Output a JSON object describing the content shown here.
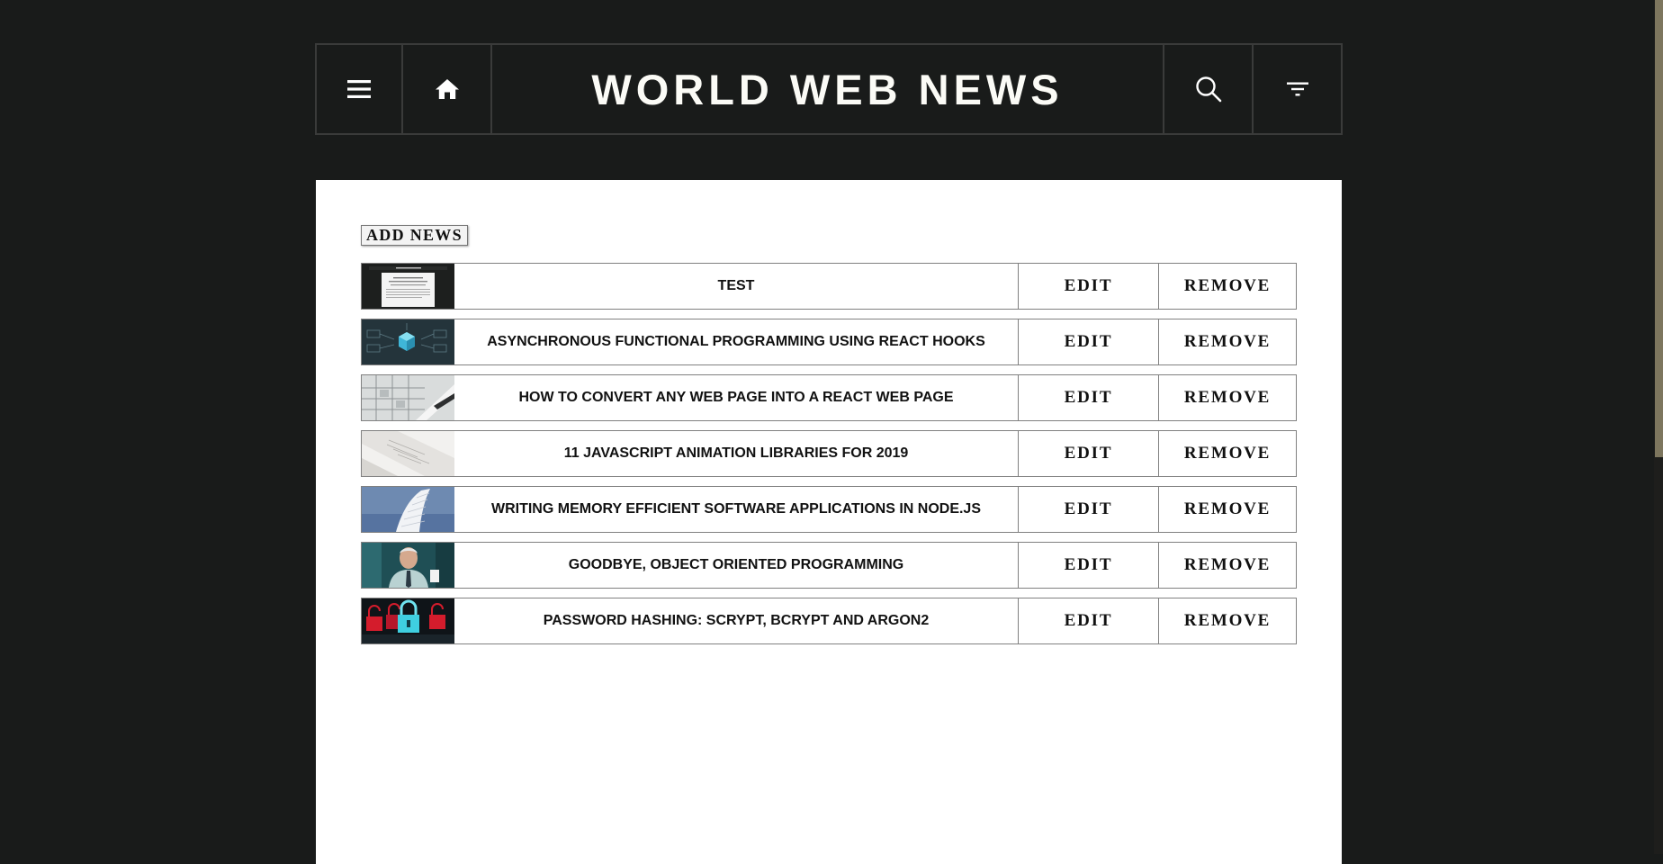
{
  "header": {
    "title": "WORLD WEB NEWS",
    "menu_icon": "hamburger-menu-icon",
    "home_icon": "home-icon",
    "search_icon": "search-icon",
    "filter_icon": "filter-icon"
  },
  "main": {
    "add_button_label": "ADD NEWS",
    "edit_label": "EDIT",
    "remove_label": "REMOVE",
    "news": [
      {
        "title": "TEST"
      },
      {
        "title": "ASYNCHRONOUS FUNCTIONAL PROGRAMMING USING REACT HOOKS"
      },
      {
        "title": "HOW TO CONVERT ANY WEB PAGE INTO A REACT WEB PAGE"
      },
      {
        "title": "11 JAVASCRIPT ANIMATION LIBRARIES FOR 2019"
      },
      {
        "title": "WRITING MEMORY EFFICIENT SOFTWARE APPLICATIONS IN NODE.JS"
      },
      {
        "title": "GOODBYE, OBJECT ORIENTED PROGRAMMING"
      },
      {
        "title": "PASSWORD HASHING: SCRYPT, BCRYPT AND ARGON2"
      }
    ]
  },
  "colors": {
    "page_background": "#191b1a",
    "header_border": "#3a3b3a",
    "panel_background": "#ffffff",
    "row_border": "#808080",
    "scrollbar_thumb": "#7d765e"
  }
}
